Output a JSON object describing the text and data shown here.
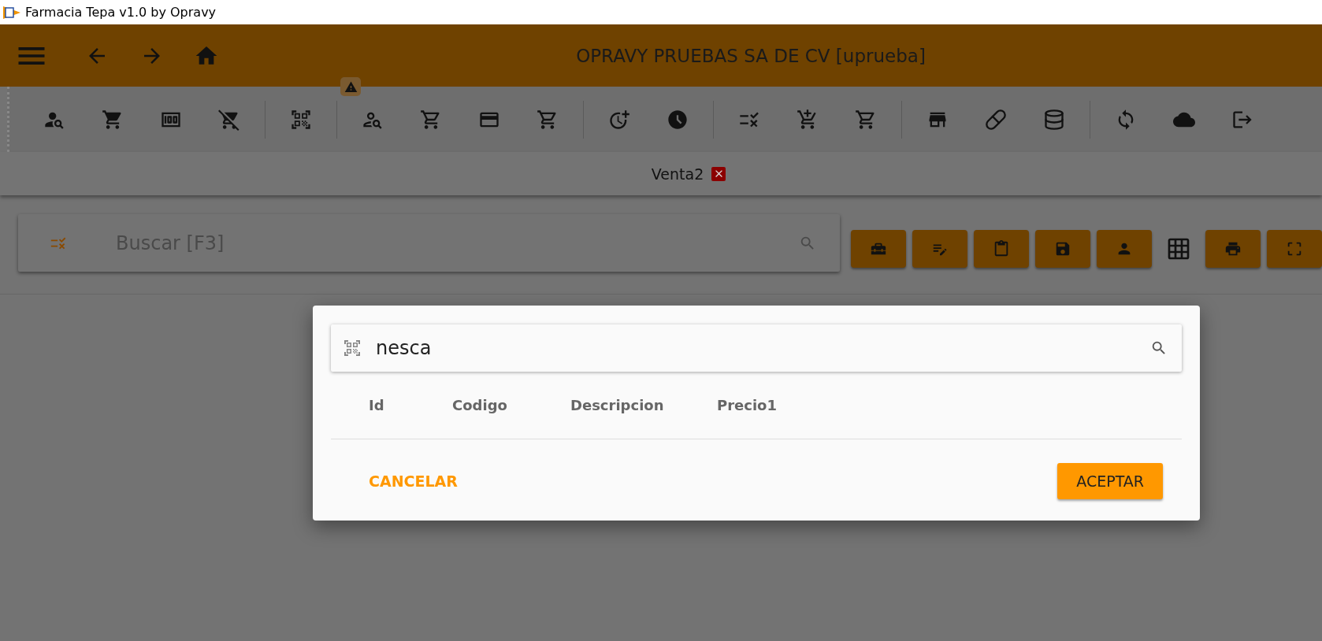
{
  "window": {
    "title": "Farmacia Tepa v1.0 by Opravy"
  },
  "header": {
    "title": "OPRAVY PRUEBAS SA DE CV [uprueba]"
  },
  "tabs": [
    {
      "label": "Venta2",
      "selected": true
    }
  ],
  "search": {
    "placeholder": "Buscar [F3]"
  },
  "dialog": {
    "search": {
      "value": "nesca"
    },
    "columns": [
      "Id",
      "Codigo",
      "Descripcion",
      "Precio1"
    ],
    "cancel": "CANCELAR",
    "accept": "ACEPTAR"
  }
}
